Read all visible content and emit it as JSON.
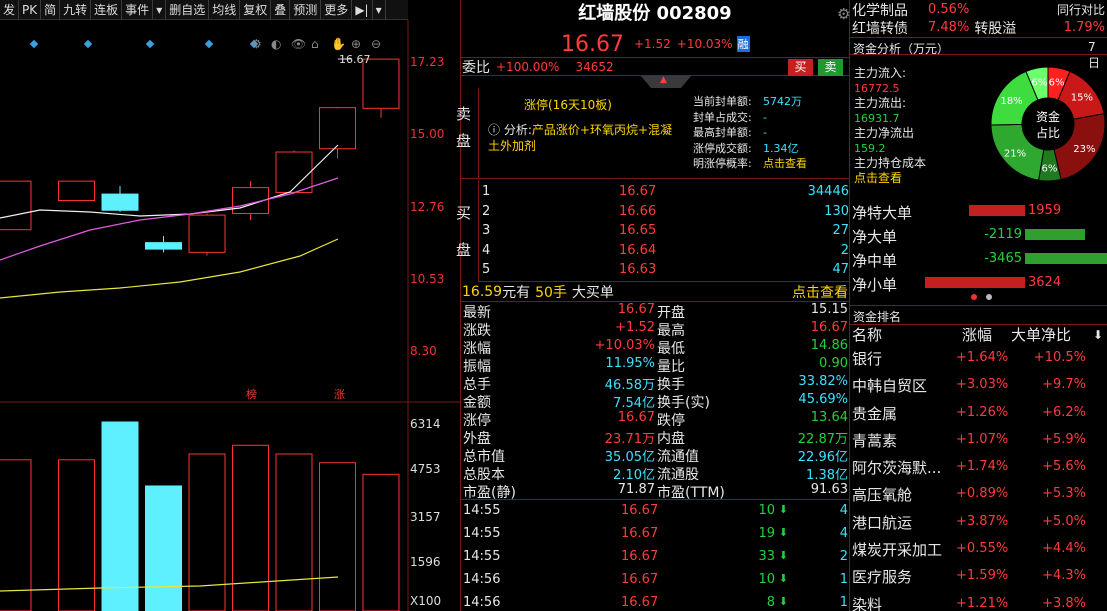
{
  "toolbar": {
    "items": [
      "发",
      "PK",
      "简",
      "九转",
      "连板",
      "事件",
      "▾",
      "删自选",
      "均线",
      "复权",
      "叠",
      "预测",
      "更多",
      "▶|",
      "▾"
    ]
  },
  "chart": {
    "price_labels": [
      "17.23",
      "15.00",
      "12.76",
      "10.53",
      "8.30"
    ],
    "last_price_tag": "16.67",
    "vol_labels": [
      "6314",
      "4753",
      "3157",
      "1596",
      "X100"
    ],
    "tag_bang": "榜",
    "tag_zhang": "涨",
    "candles": [
      {
        "o": 11.4,
        "c": 12.9,
        "h": 12.9,
        "l": 11.4,
        "col": "red"
      },
      {
        "o": 12.3,
        "c": 12.9,
        "h": 12.9,
        "l": 12.3,
        "col": "red"
      },
      {
        "o": 12.5,
        "c": 12.0,
        "h": 12.75,
        "l": 11.95,
        "col": "cyan"
      },
      {
        "o": 11.0,
        "c": 10.8,
        "h": 11.2,
        "l": 10.7,
        "col": "cyan"
      },
      {
        "o": 10.7,
        "c": 11.85,
        "h": 11.9,
        "l": 10.6,
        "col": "red"
      },
      {
        "o": 11.9,
        "c": 12.7,
        "h": 12.9,
        "l": 11.7,
        "col": "red"
      },
      {
        "o": 12.55,
        "c": 13.8,
        "h": 13.85,
        "l": 12.5,
        "col": "red"
      },
      {
        "o": 13.9,
        "c": 15.17,
        "h": 15.2,
        "l": 13.6,
        "col": "red"
      },
      {
        "o": 15.15,
        "c": 16.67,
        "h": 16.67,
        "l": 14.86,
        "col": "red"
      }
    ],
    "volumes": [
      {
        "v": 5200,
        "col": "red"
      },
      {
        "v": 5200,
        "col": "red"
      },
      {
        "v": 6500,
        "col": "cyan"
      },
      {
        "v": 4300,
        "col": "cyan"
      },
      {
        "v": 5400,
        "col": "red"
      },
      {
        "v": 5700,
        "col": "red"
      },
      {
        "v": 5400,
        "col": "red"
      },
      {
        "v": 5100,
        "col": "red"
      },
      {
        "v": 4700,
        "col": "red"
      }
    ]
  },
  "quote": {
    "name_code": "红墙股份 002809",
    "price": "16.67",
    "change": "+1.52",
    "pct": "+10.03%",
    "tag": "融",
    "weibi_label": "委比",
    "weibi": "+100.00%",
    "weicha": "34652",
    "buy": "买",
    "sell": "卖",
    "sell_label": "卖盘",
    "buy_label": "买盘",
    "limit_text": "涨停(16天10板)",
    "analysis_label": "分析:",
    "analysis_text": "产品涨价+环氧丙烷+混凝土外加剂",
    "stats": [
      {
        "label": "当前封单额:",
        "value": "5742万"
      },
      {
        "label": "封单占成交:",
        "value": "-"
      },
      {
        "label": "最高封单额:",
        "value": "-"
      },
      {
        "label": "涨停成交额:",
        "value": "1.34亿"
      },
      {
        "label": "明涨停概率:",
        "value": "点击查看"
      }
    ],
    "bids": [
      {
        "n": "1",
        "p": "16.67",
        "v": "34446"
      },
      {
        "n": "2",
        "p": "16.66",
        "v": "130"
      },
      {
        "n": "3",
        "p": "16.65",
        "v": "27"
      },
      {
        "n": "4",
        "p": "16.64",
        "v": "2"
      },
      {
        "n": "5",
        "p": "16.63",
        "v": "47"
      }
    ],
    "bigorder": {
      "price": "16.59",
      "unit": "元有",
      "hands": "50手",
      "text": "大买单",
      "link": "点击查看"
    },
    "details": [
      [
        "最新",
        "16.67",
        "r",
        "开盘",
        "15.15",
        "w"
      ],
      [
        "涨跌",
        "+1.52",
        "r",
        "最高",
        "16.67",
        "r"
      ],
      [
        "涨幅",
        "+10.03%",
        "r",
        "最低",
        "14.86",
        "g"
      ],
      [
        "振幅",
        "11.95%",
        "c",
        "量比",
        "0.90",
        "g"
      ],
      [
        "总手",
        "46.58万",
        "c",
        "换手",
        "33.82%",
        "c"
      ],
      [
        "金额",
        "7.54亿",
        "c",
        "换手(实)",
        "45.69%",
        "c"
      ],
      [
        "涨停",
        "16.67",
        "r",
        "跌停",
        "13.64",
        "g"
      ],
      [
        "外盘",
        "23.71万",
        "r",
        "内盘",
        "22.87万",
        "g"
      ],
      [
        "总市值",
        "35.05亿",
        "c",
        "流通值",
        "22.96亿",
        "c"
      ],
      [
        "总股本",
        "2.10亿",
        "c",
        "流通股",
        "1.38亿",
        "c"
      ],
      [
        "市盈(静)",
        "71.87",
        "w",
        "市盈(TTM)",
        "91.63",
        "w"
      ]
    ],
    "ticks": [
      {
        "t": "14:55",
        "p": "16.67",
        "v": "10",
        "n": "4"
      },
      {
        "t": "14:55",
        "p": "16.67",
        "v": "19",
        "n": "4"
      },
      {
        "t": "14:55",
        "p": "16.67",
        "v": "33",
        "n": "2"
      },
      {
        "t": "14:56",
        "p": "16.67",
        "v": "10",
        "n": "1"
      },
      {
        "t": "14:56",
        "p": "16.67",
        "v": "8",
        "n": "1"
      }
    ]
  },
  "right": {
    "sector1_name": "化学制品",
    "sector1_pct": "0.56%",
    "sector1_extra": "同行对比",
    "sector2_name": "红墙转债",
    "sector2_pct": "7.48%",
    "sector2_extra": "转股溢",
    "sector2_extra_val": "1.79%",
    "fund_title": "资金分析（万元）",
    "fund_tab": "7日",
    "inflow_label": "主力流入:",
    "inflow": "16772.5",
    "outflow_label": "主力流出:",
    "outflow": "16931.7",
    "net_label": "主力净流出",
    "net": "159.2",
    "cost_label": "主力持仓成本",
    "cost_link": "点击查看",
    "donut_center1": "资金",
    "donut_center2": "占比",
    "donut": [
      {
        "pct": 6,
        "color": "#ff2020",
        "label": "6%"
      },
      {
        "pct": 15,
        "color": "#c81818",
        "label": "15%"
      },
      {
        "pct": 23,
        "color": "#8a1010",
        "label": "23%"
      },
      {
        "pct": 6,
        "color": "#207a20",
        "label": "6%"
      },
      {
        "pct": 21,
        "color": "#2ea82e",
        "label": "21%"
      },
      {
        "pct": 18,
        "color": "#3fdc3f",
        "label": "18%"
      },
      {
        "pct": 6,
        "color": "#6cff6c",
        "label": "6%"
      }
    ],
    "flows": [
      {
        "label": "净特大单",
        "value": "1959",
        "dir": "pos",
        "mag": 0.28
      },
      {
        "label": "净大单",
        "value": "-2119",
        "dir": "neg",
        "mag": 0.3
      },
      {
        "label": "净中单",
        "value": "-3465",
        "dir": "neg",
        "mag": 0.48
      },
      {
        "label": "净小单",
        "value": "3624",
        "dir": "pos",
        "mag": 0.5
      }
    ],
    "rank_title": "资金排名",
    "rank_headers": [
      "名称",
      "涨幅",
      "大单净比"
    ],
    "ranks": [
      {
        "name": "银行",
        "pct": "+1.64%",
        "net": "+10.5%"
      },
      {
        "name": "中韩自贸区",
        "pct": "+3.03%",
        "net": "+9.7%"
      },
      {
        "name": "贵金属",
        "pct": "+1.26%",
        "net": "+6.2%"
      },
      {
        "name": "青蒿素",
        "pct": "+1.07%",
        "net": "+5.9%"
      },
      {
        "name": "阿尔茨海默...",
        "pct": "+1.74%",
        "net": "+5.6%"
      },
      {
        "name": "高压氧舱",
        "pct": "+0.89%",
        "net": "+5.3%"
      },
      {
        "name": "港口航运",
        "pct": "+3.87%",
        "net": "+5.0%"
      },
      {
        "name": "煤炭开采加工",
        "pct": "+0.55%",
        "net": "+4.4%"
      },
      {
        "name": "医疗服务",
        "pct": "+1.59%",
        "net": "+4.3%"
      },
      {
        "name": "染料",
        "pct": "+1.21%",
        "net": "+3.8%"
      }
    ]
  }
}
